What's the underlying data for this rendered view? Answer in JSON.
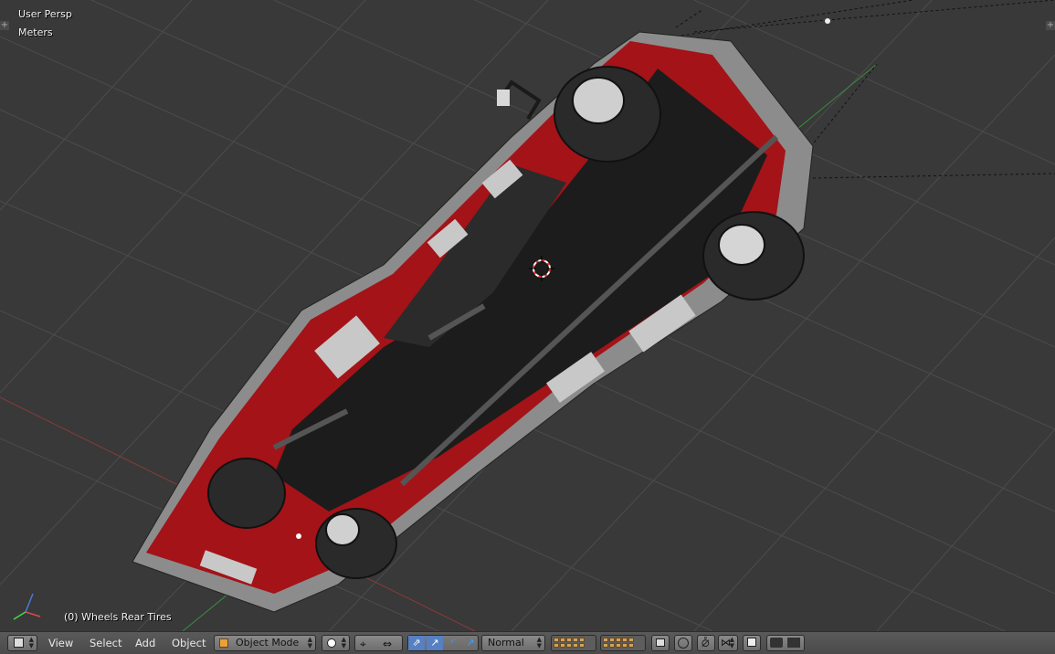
{
  "viewport": {
    "view_name": "User Persp",
    "units": "Meters",
    "selection_info": "(0) Wheels Rear Tires"
  },
  "header": {
    "menus": [
      "View",
      "Select",
      "Add",
      "Object"
    ],
    "mode": "Object Mode",
    "pivot": "Normal",
    "colors": {
      "bg": "#4a4a4a",
      "viewport": "#393939",
      "accent_blue": "#5680c2",
      "vehicle_red": "#b5121b"
    }
  },
  "icons": [
    "editor-type-icon",
    "viewport-shading-icon",
    "pivot-icon",
    "manipulator-translate-icon",
    "manipulator-rotate-icon",
    "manipulator-scale-icon",
    "layers-icon",
    "lock-icon",
    "proportional-edit-icon",
    "snap-icon",
    "render-icon",
    "render-anim-icon"
  ]
}
